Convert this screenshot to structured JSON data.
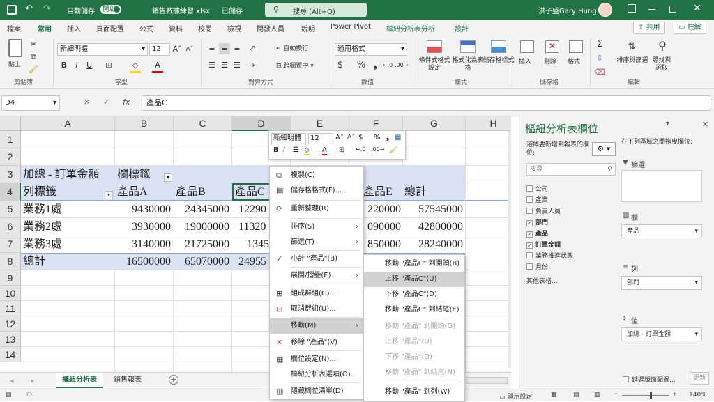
{
  "colors": {
    "brand": "#217346",
    "header_fill": "#dae3f3",
    "selected_col": "#d2d2d2"
  },
  "titlebar": {
    "autosave_label": "自動儲存",
    "autosave_state": "開啟",
    "filename": "銷售數據練習.xlsx",
    "save_status": "已儲存",
    "search_placeholder": "搜尋 (Alt+Q)",
    "user_name": "洪子盛Gary Hung"
  },
  "tabs": [
    "檔案",
    "常用",
    "插入",
    "頁面配置",
    "公式",
    "資料",
    "校閱",
    "檢視",
    "開發人員",
    "說明",
    "Power Pivot",
    "樞紐分析表分析",
    "設計"
  ],
  "share_label": "共用",
  "comment_label": "註解",
  "ribbon": {
    "paste_label": "貼上",
    "font_name": "新細明體",
    "font_size": "12",
    "wrap_label": "自動換行",
    "merge_label": "跨欄置中",
    "number_format": "通用格式",
    "cond_format": "條件式格式設定",
    "format_table": "格式化為表格",
    "cell_style": "儲存格樣式",
    "insert_label": "插入",
    "delete_label": "刪除",
    "format_label": "格式",
    "sort_filter": "排序與篩選",
    "find_select": "尋找與選取",
    "groups": [
      "剪貼簿",
      "字型",
      "對齊方式",
      "數值",
      "樣式",
      "儲存格",
      "編輯"
    ]
  },
  "formula_bar": {
    "name_box": "D4",
    "fx": "fx",
    "content": "產品C"
  },
  "grid": {
    "columns": [
      "A",
      "B",
      "C",
      "D",
      "E",
      "F",
      "G",
      "H"
    ],
    "rows": [
      "1",
      "2",
      "3",
      "4",
      "5",
      "6",
      "7",
      "8",
      "9",
      "10",
      "11",
      "12",
      "13",
      "14"
    ],
    "r3": {
      "a": "加總 - 訂單金額",
      "b": "欄標籤"
    },
    "r4": {
      "a": "列標籤",
      "b": "產品A",
      "c": "產品B",
      "d": "產品C",
      "f": "產品E",
      "g": "總計"
    },
    "data_rows": [
      {
        "a": "業務1處",
        "b": "9430000",
        "c": "24345000",
        "d": "12290",
        "f": "220000",
        "g": "57545000"
      },
      {
        "a": "業務2處",
        "b": "3930000",
        "c": "19000000",
        "d": "11320",
        "f": "090000",
        "g": "42800000"
      },
      {
        "a": "業務3處",
        "b": "3140000",
        "c": "21725000",
        "d": "1345",
        "f": "850000",
        "g": "28240000"
      }
    ],
    "total_row": {
      "a": "總計",
      "b": "16500000",
      "c": "65070000",
      "d": "24955"
    }
  },
  "sheet_tabs": [
    "樞紐分析表",
    "銷售報表"
  ],
  "status": {
    "display_settings": "顯示設定",
    "zoom": "140%"
  },
  "mini_toolbar": {
    "font": "新細明體",
    "size": "12"
  },
  "context_menu": [
    {
      "label": "複製(C)",
      "icon": "copy-icon"
    },
    {
      "label": "儲存格格式(F)...",
      "icon": "format-cells-icon"
    },
    {
      "label": "重新整理(R)",
      "icon": "refresh-icon"
    },
    {
      "label": "排序(S)",
      "submenu": true
    },
    {
      "label": "篩選(T)",
      "submenu": true
    },
    {
      "label": "小計 \"產品\"(B)",
      "check": true
    },
    {
      "label": "展開/摺疊(E)",
      "submenu": true
    },
    {
      "label": "組成群組(G)...",
      "icon": "group-icon"
    },
    {
      "label": "取消群組(U)...",
      "icon": "ungroup-icon"
    },
    {
      "label": "移動(M)",
      "submenu": true,
      "highlight": true
    },
    {
      "label": "移除 \"產品\"(V)",
      "icon": "remove-icon"
    },
    {
      "label": "欄位設定(N)...",
      "icon": "field-settings-icon"
    },
    {
      "label": "樞紐分析表選項(O)..."
    },
    {
      "label": "隱藏欄位清單(D)",
      "icon": "field-list-icon"
    }
  ],
  "move_submenu": [
    {
      "label": "移動 \"產品C\" 到開頭(B)"
    },
    {
      "label": "上移 \"產品C\"(U)",
      "highlight": true
    },
    {
      "label": "下移 \"產品C\"(D)"
    },
    {
      "label": "移動 \"產品C\" 到結尾(E)"
    },
    {
      "label": "移動 \"產品\" 到開頭(G)",
      "disabled": true
    },
    {
      "label": "上移 \"產品\"(U)",
      "disabled": true
    },
    {
      "label": "下移 \"產品\"(D)",
      "disabled": true
    },
    {
      "label": "移動 \"產品\" 到結尾(N)",
      "disabled": true
    },
    {
      "label": "移動 \"產品\" 到列(W)"
    }
  ],
  "pivot_pane": {
    "title": "樞紐分析表欄位",
    "choose_label": "選擇要新增到報表的欄位:",
    "drag_label": "在下列區域之間拖曳欄位:",
    "search_placeholder": "搜尋",
    "fields": [
      {
        "name": "公司",
        "checked": false
      },
      {
        "name": "產業",
        "checked": false
      },
      {
        "name": "負責人員",
        "checked": false
      },
      {
        "name": "部門",
        "checked": true
      },
      {
        "name": "產品",
        "checked": true
      },
      {
        "name": "訂單金額",
        "checked": true
      },
      {
        "name": "業務推進狀態",
        "checked": false
      },
      {
        "name": "月份",
        "checked": false
      }
    ],
    "more_tables": "其他表格...",
    "filter_label": "篩選",
    "columns_label": "欄",
    "columns_value": "產品",
    "rows_label": "列",
    "rows_value": "部門",
    "values_label": "值",
    "values_value": "加總 - 訂單金額",
    "defer_label": "延遲版面配置...",
    "update_label": "更新"
  }
}
